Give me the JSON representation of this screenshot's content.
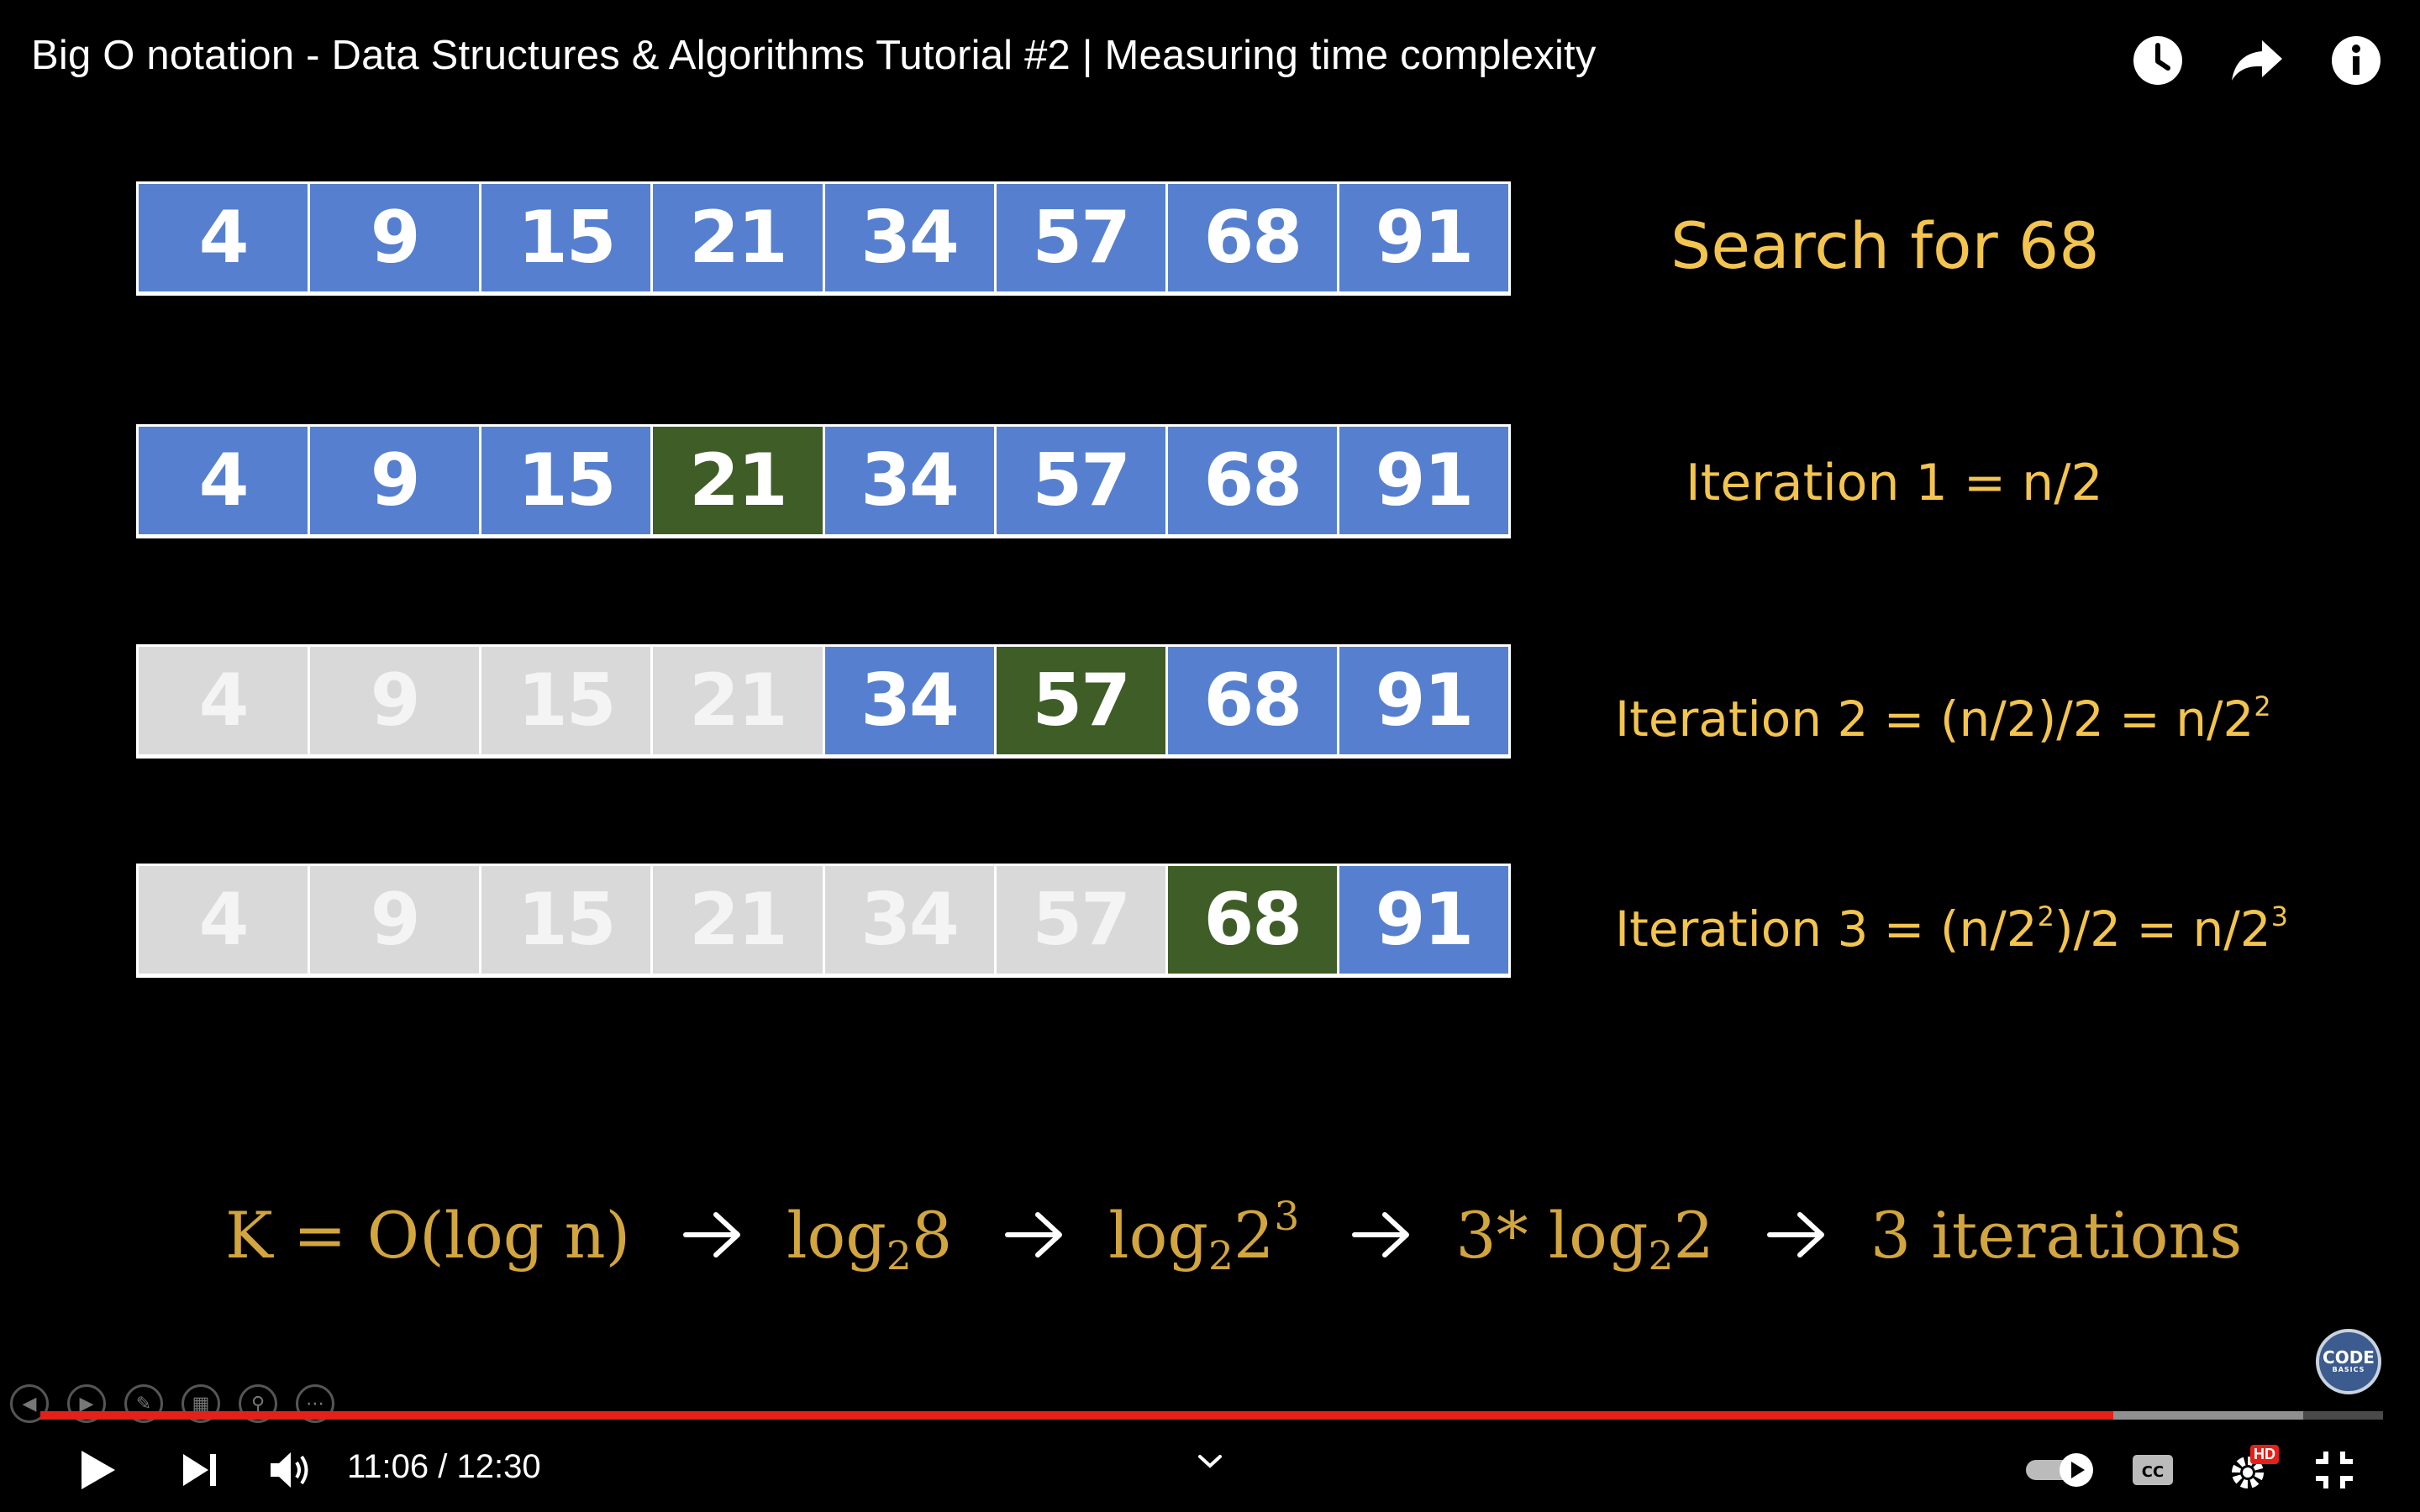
{
  "video": {
    "title": "Big O notation - Data Structures & Algorithms Tutorial #2 | Measuring time complexity"
  },
  "top_icons": [
    "watch-later-icon",
    "share-icon",
    "info-icon"
  ],
  "slide": {
    "rows": [
      {
        "cells": [
          {
            "value": "4",
            "state": "blue"
          },
          {
            "value": "9",
            "state": "blue"
          },
          {
            "value": "15",
            "state": "blue"
          },
          {
            "value": "21",
            "state": "blue"
          },
          {
            "value": "34",
            "state": "blue"
          },
          {
            "value": "57",
            "state": "blue"
          },
          {
            "value": "68",
            "state": "blue"
          },
          {
            "value": "91",
            "state": "blue"
          }
        ],
        "label": "Search for 68"
      },
      {
        "cells": [
          {
            "value": "4",
            "state": "blue"
          },
          {
            "value": "9",
            "state": "blue"
          },
          {
            "value": "15",
            "state": "blue"
          },
          {
            "value": "21",
            "state": "green"
          },
          {
            "value": "34",
            "state": "blue"
          },
          {
            "value": "57",
            "state": "blue"
          },
          {
            "value": "68",
            "state": "blue"
          },
          {
            "value": "91",
            "state": "blue"
          }
        ],
        "label": "Iteration 1 = n/2"
      },
      {
        "cells": [
          {
            "value": "4",
            "state": "grey"
          },
          {
            "value": "9",
            "state": "grey"
          },
          {
            "value": "15",
            "state": "grey"
          },
          {
            "value": "21",
            "state": "grey"
          },
          {
            "value": "34",
            "state": "blue"
          },
          {
            "value": "57",
            "state": "green"
          },
          {
            "value": "68",
            "state": "blue"
          },
          {
            "value": "91",
            "state": "blue"
          }
        ],
        "label_parts": [
          "Iteration 2 = (n/2)/2 = n/2",
          "2"
        ]
      },
      {
        "cells": [
          {
            "value": "4",
            "state": "grey"
          },
          {
            "value": "9",
            "state": "grey"
          },
          {
            "value": "15",
            "state": "grey"
          },
          {
            "value": "21",
            "state": "grey"
          },
          {
            "value": "34",
            "state": "grey"
          },
          {
            "value": "57",
            "state": "grey"
          },
          {
            "value": "68",
            "state": "green"
          },
          {
            "value": "91",
            "state": "blue"
          }
        ],
        "label_parts": [
          "Iteration 3 = (n/2",
          "2",
          ")/2 = n/2",
          "3"
        ]
      }
    ],
    "formula": {
      "t1": "K = O(log n)",
      "t2_base": "log",
      "t2_sub": "2",
      "t2_tail": "8",
      "t3_base": "log",
      "t3_sub": "2",
      "t3_tail": "2",
      "t3_sup": "3",
      "t4_pre": "3* log",
      "t4_sub": "2",
      "t4_tail": "2",
      "t5": "3 iterations"
    },
    "logo": {
      "line1": "CODE",
      "line2": "BASICS"
    }
  },
  "player": {
    "progress": {
      "played": 0.885,
      "buffered": 0.966
    },
    "time_current": "11:06",
    "time_separator": " / ",
    "time_total": "12:30",
    "colors": {
      "progress": "#e52019",
      "hd_badge": "#e52019"
    },
    "hd_label": "HD"
  },
  "colors": {
    "cell_blue": "#5680cf",
    "cell_green": "#3f5d26",
    "cell_grey": "#d9d9d9",
    "label_gold": "#f3c44e",
    "formula_gold": "#d2a53e"
  }
}
